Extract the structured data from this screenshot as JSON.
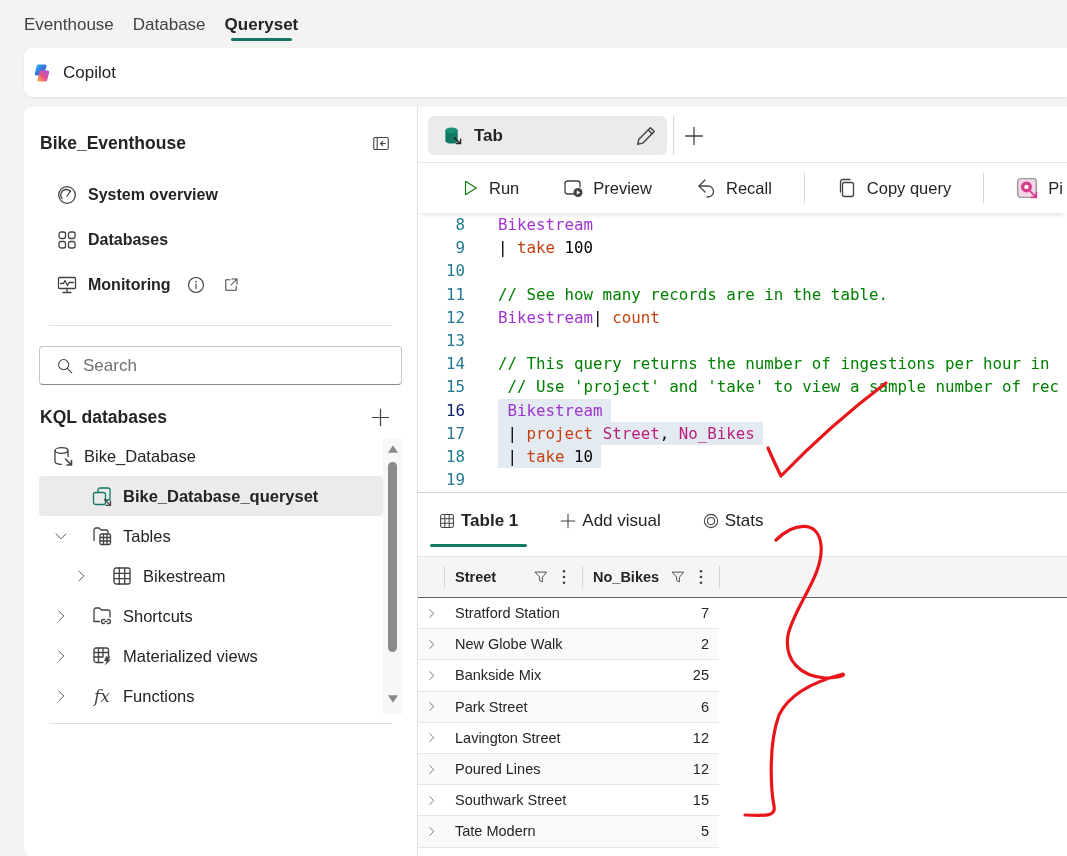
{
  "top_tabs": [
    {
      "label": "Eventhouse",
      "selected": false
    },
    {
      "label": "Database",
      "selected": false
    },
    {
      "label": "Queryset",
      "selected": true
    }
  ],
  "copilot": {
    "label": "Copilot"
  },
  "sidebar": {
    "title": "Bike_Eventhouse",
    "nav_items": [
      {
        "label": "System overview",
        "kind": "overview"
      },
      {
        "label": "Databases",
        "kind": "databases"
      },
      {
        "label": "Monitoring",
        "kind": "monitoring",
        "info": true,
        "external_link": true
      }
    ],
    "search": {
      "placeholder": "Search"
    },
    "section_title": "KQL databases",
    "tree": [
      {
        "label": "Bike_Database",
        "kind": "database",
        "selected": false,
        "children": [
          {
            "label": "Bike_Database_queryset",
            "kind": "queryset",
            "selected": true
          },
          {
            "label": "Tables",
            "kind": "tables",
            "selected": false,
            "expanded": true,
            "children": [
              {
                "label": "Bikestream",
                "kind": "table",
                "selected": false,
                "expanded": false
              }
            ]
          },
          {
            "label": "Shortcuts",
            "kind": "shortcuts",
            "selected": false,
            "expanded": false
          },
          {
            "label": "Materialized views",
            "kind": "materialized_views",
            "selected": false,
            "expanded": false
          },
          {
            "label": "Functions",
            "kind": "functions",
            "icon_text": "fx",
            "selected": false,
            "expanded": false
          }
        ]
      }
    ]
  },
  "query_tabs": [
    {
      "label": "Tab",
      "selected": true
    }
  ],
  "toolbar": [
    {
      "label": "Run",
      "kind": "run"
    },
    {
      "label": "Preview",
      "kind": "preview"
    },
    {
      "label": "Recall",
      "kind": "recall"
    },
    {
      "kind": "separator"
    },
    {
      "label": "Copy query",
      "kind": "copy"
    },
    {
      "kind": "separator"
    },
    {
      "label": "Pi",
      "kind": "pin"
    }
  ],
  "editor": {
    "lines": [
      {
        "number": "8",
        "selected": false,
        "current": false,
        "tokens": [
          {
            "text": "Bikestream",
            "kind": "table"
          }
        ]
      },
      {
        "number": "9",
        "selected": false,
        "current": false,
        "tokens": [
          {
            "text": "| ",
            "kind": "plain"
          },
          {
            "text": "take",
            "kind": "keyword"
          },
          {
            "text": " 100",
            "kind": "plain"
          }
        ]
      },
      {
        "number": "10",
        "selected": false,
        "current": false
      },
      {
        "number": "11",
        "selected": false,
        "current": false,
        "tokens": [
          {
            "text": "// See how many records are in the table.",
            "kind": "comment"
          }
        ]
      },
      {
        "number": "12",
        "selected": false,
        "current": false,
        "tokens": [
          {
            "text": "Bikestream",
            "kind": "table"
          },
          {
            "text": "| ",
            "kind": "plain"
          },
          {
            "text": "count",
            "kind": "keyword"
          }
        ]
      },
      {
        "number": "13",
        "selected": false,
        "current": false
      },
      {
        "number": "14",
        "selected": false,
        "current": false,
        "tokens": [
          {
            "text": "// This query returns the number of ingestions per hour in",
            "kind": "comment"
          }
        ]
      },
      {
        "number": "15",
        "selected": false,
        "current": false,
        "tokens": [
          {
            "text": " // Use 'project' and 'take' to view a sample number of rec",
            "kind": "comment"
          }
        ]
      },
      {
        "number": "16",
        "selected": true,
        "current": true,
        "tokens": [
          {
            "text": " Bikestream",
            "kind": "table"
          }
        ]
      },
      {
        "number": "17",
        "selected": true,
        "current": false,
        "tokens": [
          {
            "text": " | ",
            "kind": "plain"
          },
          {
            "text": "project",
            "kind": "keyword"
          },
          {
            "text": " Street",
            "kind": "column"
          },
          {
            "text": ", ",
            "kind": "plain"
          },
          {
            "text": "No_Bikes",
            "kind": "column"
          }
        ]
      },
      {
        "number": "18",
        "selected": true,
        "current": false,
        "tokens": [
          {
            "text": " | ",
            "kind": "plain"
          },
          {
            "text": "take",
            "kind": "keyword"
          },
          {
            "text": " 10",
            "kind": "plain"
          }
        ]
      },
      {
        "number": "19",
        "selected": false,
        "current": false
      }
    ],
    "annotation": {
      "kind": "checkmark"
    }
  },
  "result_tabs": [
    {
      "label": "Table 1",
      "kind": "table",
      "selected": true
    },
    {
      "label": "Add visual",
      "kind": "add",
      "selected": false
    },
    {
      "label": "Stats",
      "kind": "stats",
      "selected": false
    }
  ],
  "table": {
    "columns": [
      "Street",
      "No_Bikes"
    ],
    "rows": [
      {
        "cells": [
          "Stratford Station",
          "7"
        ],
        "expanded": false
      },
      {
        "cells": [
          "New Globe Walk",
          "2"
        ],
        "expanded": false
      },
      {
        "cells": [
          "Bankside Mix",
          "25"
        ],
        "expanded": false
      },
      {
        "cells": [
          "Park Street",
          "6"
        ],
        "expanded": false
      },
      {
        "cells": [
          "Lavington Street",
          "12"
        ],
        "expanded": false
      },
      {
        "cells": [
          "Poured Lines",
          "12"
        ],
        "expanded": false
      },
      {
        "cells": [
          "Southwark Street",
          "15"
        ],
        "expanded": false
      },
      {
        "cells": [
          "Tate Modern",
          "5"
        ],
        "expanded": false
      }
    ],
    "annotation": {
      "kind": "brace"
    }
  }
}
